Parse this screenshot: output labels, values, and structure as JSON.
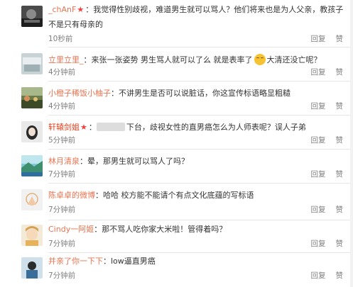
{
  "comments": [
    {
      "name": "_chAnF",
      "badge": "★",
      "sep": "：",
      "text_line1": "我觉得性别歧视，难道男生就可以骂人？他们将来也是为人父亲，教孩子",
      "text_line2": "不是只有母亲的",
      "time": "10秒前",
      "reply": "回复",
      "like": "赞"
    },
    {
      "name": "立里立里_",
      "sep": "：",
      "text_a": "来张一张姿势 男生骂人就可以了么 就是表率了",
      "emoji_name": "smile-emoji",
      "text_b": "大清还没亡呢？",
      "time": "4分钟前",
      "reply": "回复",
      "like": "赞"
    },
    {
      "name": "小橙子稀饭小柚子",
      "sep": "：",
      "text": "不讲男生是否可以说脏话，你这宣传标语略显粗糙",
      "time": "4分钟前",
      "reply": "回复",
      "like": "赞"
    },
    {
      "name": "轩辕剑姐",
      "badge": "★",
      "sep": "：",
      "text": "下台，歧视女性的直男癌怎么为人师表呢？误人子弟",
      "time": "5分钟前",
      "reply": "回复",
      "like": "赞"
    },
    {
      "name": "林月清泉",
      "sep": "：",
      "text": "晕，那男生就可以骂人了吗？",
      "time": "7分钟前",
      "reply": "回复",
      "like": "赞"
    },
    {
      "name": "陈卓卓的微博",
      "sep": "：",
      "text": "哈哈 校方能不能请个有点文化底蕴的写标语",
      "time": "7分钟前",
      "reply": "回复",
      "like": "赞"
    },
    {
      "name": "Cindy一阿姬",
      "sep": "：",
      "text": "那不骂人吃你家大米啦！管得着吗？",
      "time": "7分钟前",
      "reply": "回复",
      "like": "赞"
    },
    {
      "name": "并亲了你一下下",
      "sep": "：",
      "text": "low逼直男癌",
      "time": "7分钟前",
      "reply": "回复",
      "like": "赞"
    }
  ],
  "colors": {
    "name": "#eb7350",
    "badge": "#f0413c",
    "text": "#333333",
    "meta": "#808080",
    "divider": "#e6e6e6"
  }
}
